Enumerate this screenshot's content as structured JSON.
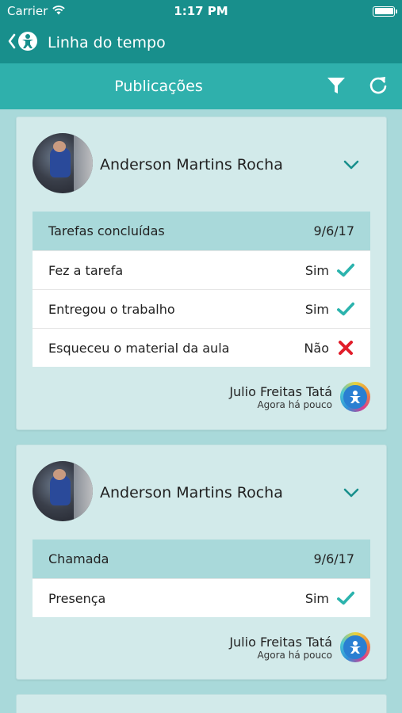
{
  "status_bar": {
    "carrier": "Carrier",
    "time": "1:17 PM"
  },
  "nav": {
    "title": "Linha do tempo"
  },
  "subheader": {
    "title": "Publicações"
  },
  "colors": {
    "primary": "#188f8c",
    "secondary": "#2fb0ac",
    "background": "#a9d9da",
    "card": "#d2eaea",
    "check": "#2bb3ad",
    "cross": "#e11d2a"
  },
  "posts": [
    {
      "student": "Anderson Martins Rocha",
      "category": "Tarefas concluídas",
      "date": "9/6/17",
      "rows": [
        {
          "label": "Fez a tarefa",
          "value": "Sim",
          "icon": "check-icon"
        },
        {
          "label": "Entregou o trabalho",
          "value": "Sim",
          "icon": "check-icon"
        },
        {
          "label": "Esqueceu o material da aula",
          "value": "Não",
          "icon": "cross-icon"
        }
      ],
      "author": "Julio Freitas Tatá",
      "time": "Agora há pouco"
    },
    {
      "student": "Anderson Martins Rocha",
      "category": "Chamada",
      "date": "9/6/17",
      "rows": [
        {
          "label": "Presença",
          "value": "Sim",
          "icon": "check-icon"
        }
      ],
      "author": "Julio Freitas Tatá",
      "time": "Agora há pouco"
    }
  ]
}
